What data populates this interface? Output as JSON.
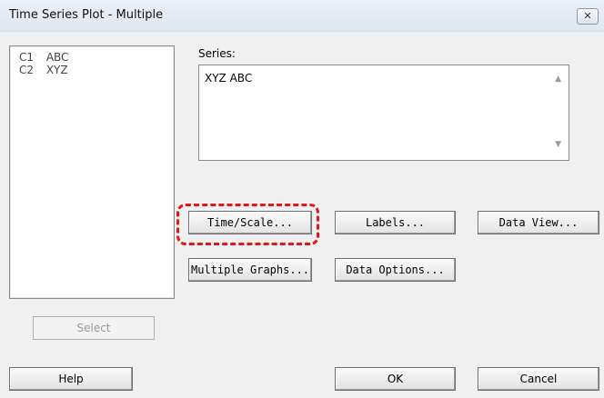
{
  "window": {
    "title": "Time Series Plot - Multiple",
    "close_label": "⊠"
  },
  "variables": [
    {
      "col": "C1",
      "name": "ABC"
    },
    {
      "col": "C2",
      "name": "XYZ"
    }
  ],
  "series": {
    "label": "Series:",
    "value": "XYZ ABC"
  },
  "buttons": {
    "time_scale": "Time/Scale...",
    "labels": "Labels...",
    "data_view": "Data View...",
    "multiple_graphs": "Multiple Graphs...",
    "data_options": "Data Options...",
    "select": "Select",
    "help": "Help",
    "ok": "OK",
    "cancel": "Cancel"
  },
  "colors": {
    "highlight": "#e01818"
  }
}
